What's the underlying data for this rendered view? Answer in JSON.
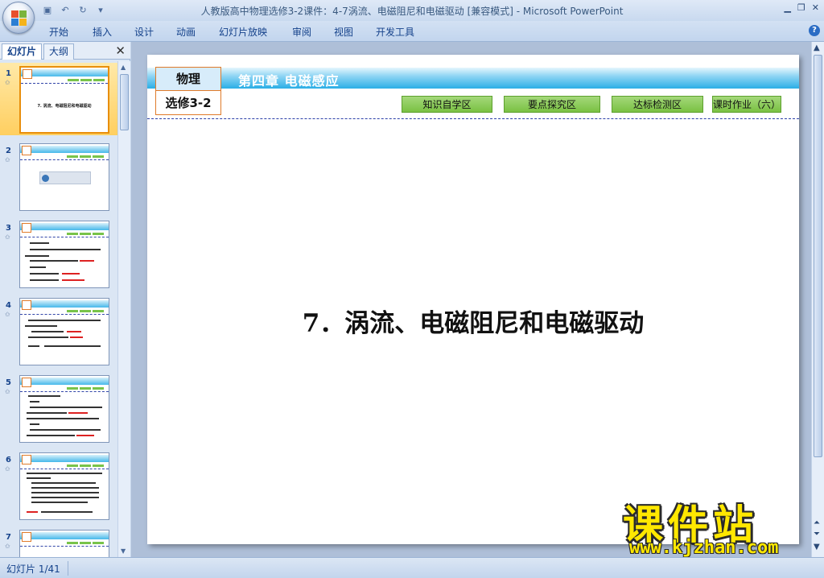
{
  "window": {
    "title": "人教版高中物理选修3-2课件：4-7涡流、电磁阻尼和电磁驱动 [兼容模式] - Microsoft PowerPoint"
  },
  "ribbon": {
    "tabs": [
      "开始",
      "插入",
      "设计",
      "动画",
      "幻灯片放映",
      "审阅",
      "视图",
      "开发工具"
    ]
  },
  "left_panel": {
    "tabs": [
      "幻灯片",
      "大纲"
    ],
    "thumbnails": [
      {
        "num": "1",
        "title": "7. 涡流、电磁阻尼和电磁驱动"
      },
      {
        "num": "2"
      },
      {
        "num": "3"
      },
      {
        "num": "4"
      },
      {
        "num": "5"
      },
      {
        "num": "6"
      },
      {
        "num": "7"
      }
    ]
  },
  "slide": {
    "subject": "物理",
    "course": "选修3-2",
    "chapter": "第四章  电磁感应",
    "nav_buttons": [
      "知识自学区",
      "要点探究区",
      "达标检测区",
      "课时作业（六）"
    ],
    "title": "7．涡流、电磁阻尼和电磁驱动"
  },
  "status": {
    "slide_indicator": "幻灯片 1/41"
  },
  "watermark": {
    "brand": "课件站",
    "url": "www.kjzhan.com"
  },
  "colors": {
    "banner_blue": "#2aaee6",
    "nav_green": "#7ac143",
    "box_orange": "#e07b2a",
    "selected_thumb": "#ffcf60",
    "watermark_yellow": "#ffe800"
  }
}
